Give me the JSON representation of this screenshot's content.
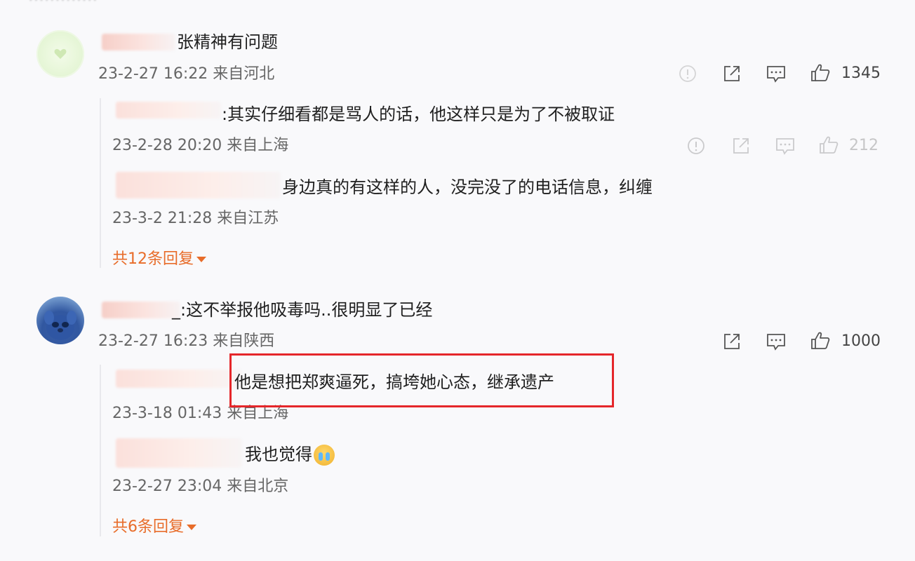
{
  "header": {
    "fade_text": "·············"
  },
  "comments": [
    {
      "text": "张精神有问题",
      "meta": "23-2-27 16:22 来自河北",
      "likes": "1345",
      "replies": [
        {
          "text": ":其实仔细看都是骂人的话，他这样只是为了不被取证",
          "meta": "23-2-28 20:20 来自上海",
          "likes": "212"
        },
        {
          "text": "身边真的有这样的人，没完没了的电话信息，纠缠",
          "meta": "23-3-2 21:28 来自江苏"
        }
      ],
      "more": "共12条回复"
    },
    {
      "text": "_:这不举报他吸毒吗..很明显了已经",
      "meta": "23-2-27 16:23 来自陕西",
      "likes": "1000",
      "replies": [
        {
          "text": "他是想把郑爽逼死，搞垮她心态，继承遗产",
          "meta": "23-3-18 01:43 来自上海"
        },
        {
          "text": "我也觉得",
          "meta": "23-2-27 23:04 来自北京"
        }
      ],
      "more": "共6条回复"
    }
  ],
  "icons": {
    "report": "exclamation-circle-icon",
    "share": "share-icon",
    "comment": "comment-icon",
    "like": "thumbs-up-icon"
  },
  "colors": {
    "accent": "#e86c29",
    "highlight": "#e5262a",
    "meta": "#666666"
  }
}
